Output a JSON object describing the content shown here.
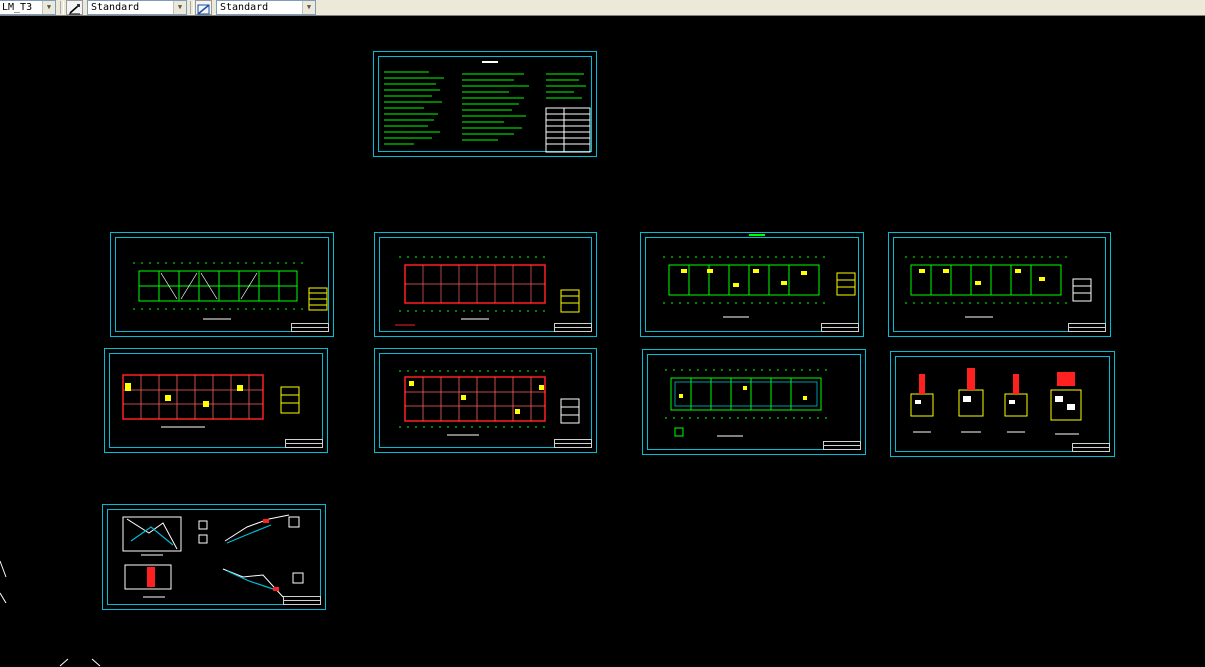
{
  "toolbar": {
    "layer_value": "LM_T3",
    "text_style_value": "Standard",
    "dim_style_value": "Standard",
    "icons": [
      "text-style-icon",
      "dimension-style-icon"
    ]
  },
  "colors": {
    "background": "#000000",
    "frame": "#00bcd4",
    "green": "#00ff00",
    "red": "#ff2020",
    "yellow": "#ffff00",
    "white": "#ffffff"
  }
}
